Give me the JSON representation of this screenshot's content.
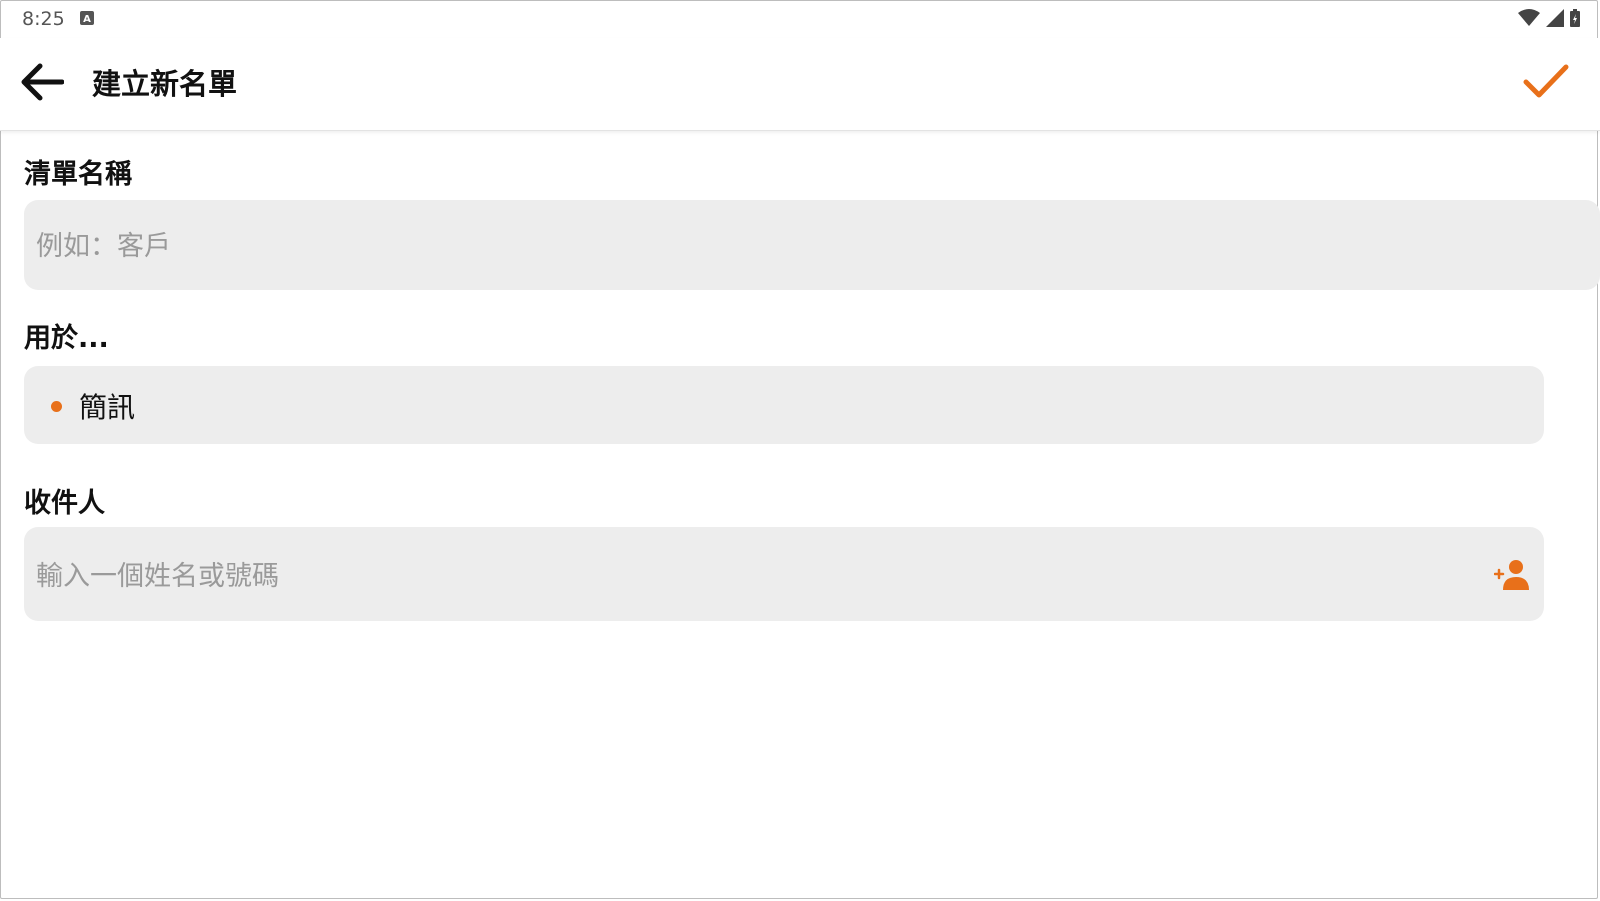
{
  "status_bar": {
    "time": "8:25",
    "keyboard_icon": "a-badge-icon",
    "wifi_icon": "wifi-icon",
    "signal_icon": "signal-icon",
    "battery_icon": "battery-icon"
  },
  "app_bar": {
    "title": "建立新名單",
    "back_icon": "arrow-left-icon",
    "confirm_icon": "checkmark-icon"
  },
  "form": {
    "list_name": {
      "label": "清單名稱",
      "placeholder": "例如：客戶",
      "value": ""
    },
    "used_for": {
      "label": "用於...",
      "selected_option": "簡訊"
    },
    "recipients": {
      "label": "收件人",
      "placeholder": "輸入一個姓名或號碼",
      "value": "",
      "add_icon": "add-person-icon"
    }
  },
  "colors": {
    "accent": "#e8701a",
    "field_background": "#ededed",
    "placeholder_text": "#9a9a9a"
  }
}
